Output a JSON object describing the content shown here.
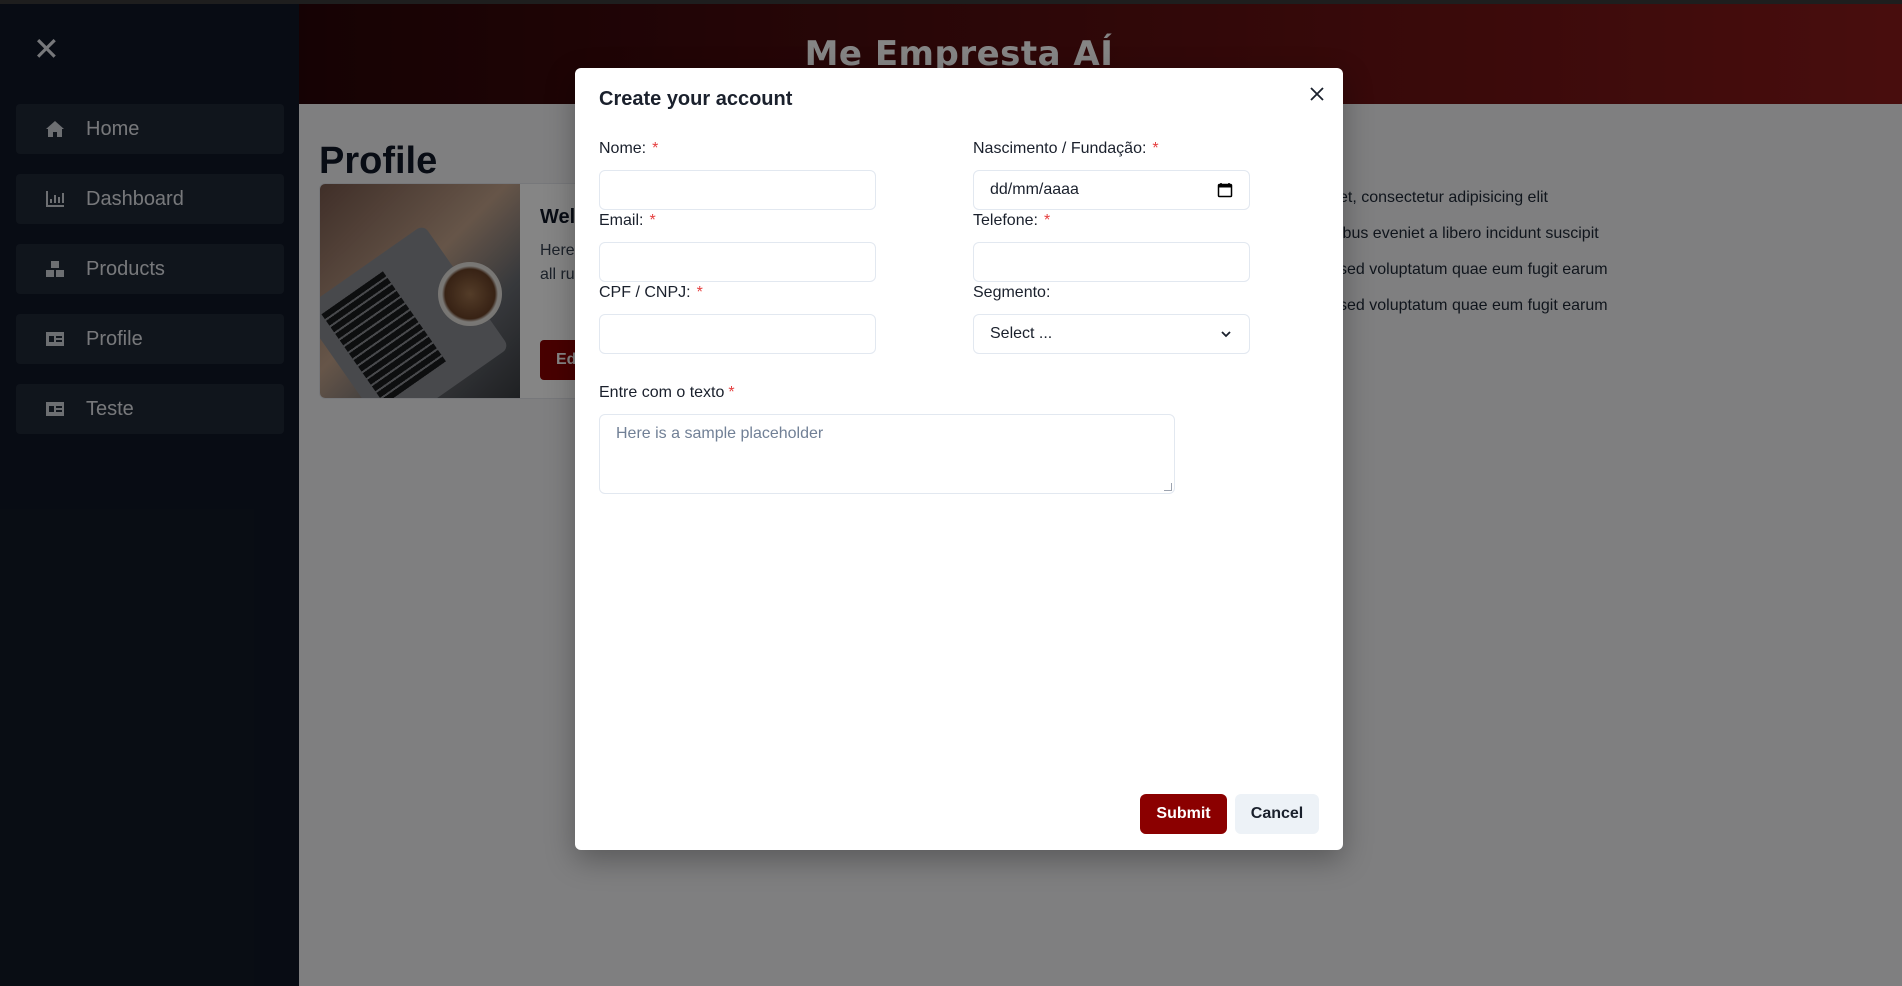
{
  "sidebar": {
    "close_icon": "close-icon",
    "items": [
      {
        "label": "Home",
        "icon": "home-icon"
      },
      {
        "label": "Dashboard",
        "icon": "chart-icon"
      },
      {
        "label": "Products",
        "icon": "boxes-icon"
      },
      {
        "label": "Profile",
        "icon": "id-card-icon"
      },
      {
        "label": "Teste",
        "icon": "id-card-icon"
      }
    ]
  },
  "header": {
    "brand": "Me Empresta AÍ"
  },
  "main": {
    "title": "Profile",
    "card": {
      "title": "Wel",
      "text_line1": "Here",
      "text_line2": "all ru",
      "button": "Ed"
    },
    "lorem": [
      "et, consectetur adipisicing elit",
      "ibus eveniet a libero incidunt suscipit",
      "sed voluptatum quae eum fugit earum",
      "sed voluptatum quae eum fugit earum"
    ]
  },
  "modal": {
    "title": "Create your account",
    "fields": {
      "nome": {
        "label": "Nome:",
        "required": "*",
        "value": ""
      },
      "nascimento": {
        "label": "Nascimento / Fundação:",
        "required": "*",
        "value": "dd/mm/aaaa"
      },
      "email": {
        "label": "Email:",
        "required": "*",
        "value": ""
      },
      "telefone": {
        "label": "Telefone:",
        "required": "*",
        "value": ""
      },
      "cpf": {
        "label": "CPF / CNPJ:",
        "required": "*",
        "value": ""
      },
      "segmento": {
        "label": "Segmento:",
        "value": "Select ..."
      },
      "texto": {
        "label": "Entre com o texto",
        "required": "*",
        "placeholder": "Here is a sample placeholder"
      }
    },
    "submit_label": "Submit",
    "cancel_label": "Cancel"
  },
  "colors": {
    "accent": "#8b0000",
    "sidebar_bg": "#111827",
    "required": "#e53e3e"
  }
}
